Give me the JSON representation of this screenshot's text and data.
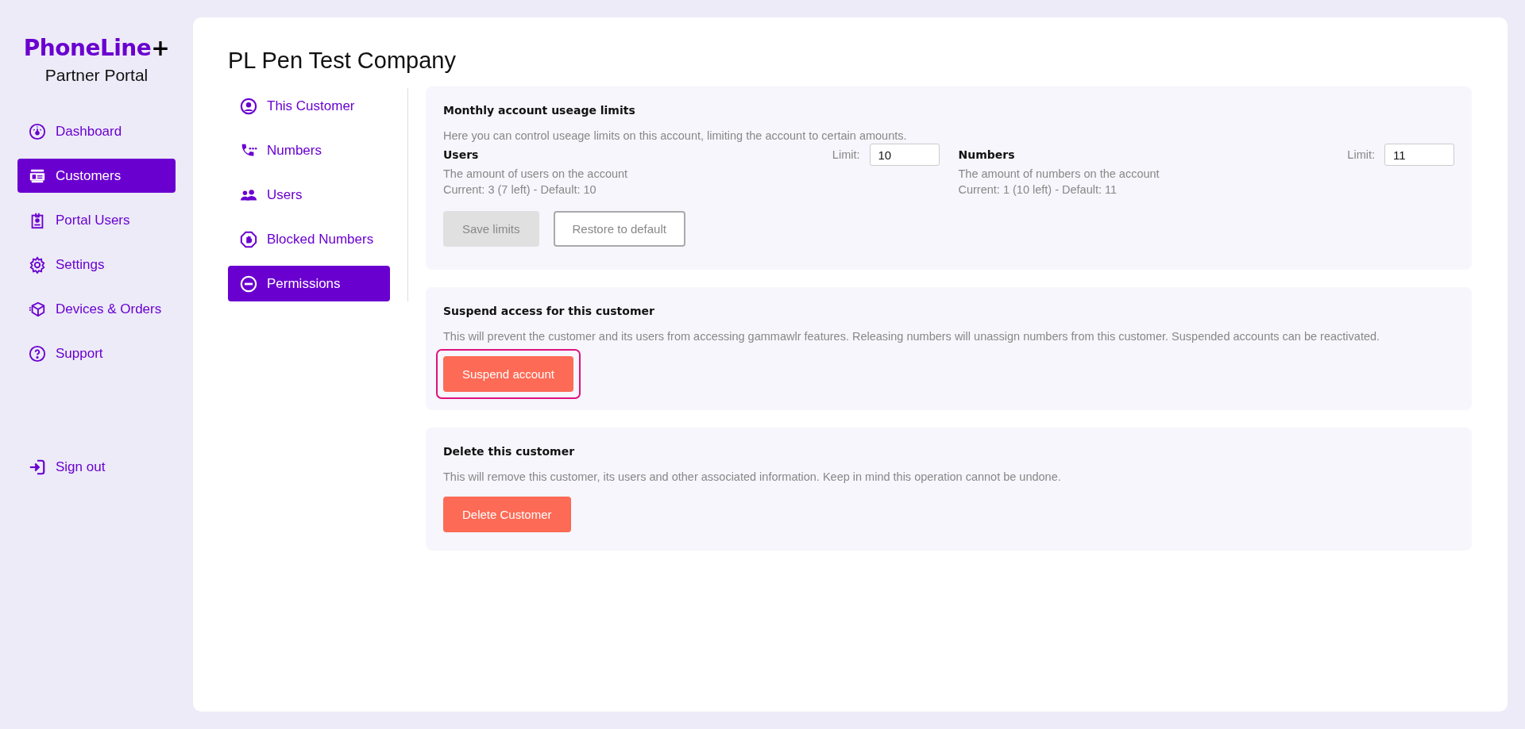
{
  "sidebar": {
    "logo": {
      "name": "PhoneLine",
      "mark": "+"
    },
    "subtitle": "Partner Portal",
    "items": [
      {
        "label": "Dashboard",
        "selected": false
      },
      {
        "label": "Customers",
        "selected": true
      },
      {
        "label": "Portal Users",
        "selected": false
      },
      {
        "label": "Settings",
        "selected": false
      },
      {
        "label": "Devices & Orders",
        "selected": false
      },
      {
        "label": "Support",
        "selected": false
      }
    ],
    "sign_out": "Sign out"
  },
  "page": {
    "title": "PL Pen Test Company"
  },
  "tabs": [
    {
      "label": "This Customer",
      "selected": false
    },
    {
      "label": "Numbers",
      "selected": false
    },
    {
      "label": "Users",
      "selected": false
    },
    {
      "label": "Blocked Numbers",
      "selected": false
    },
    {
      "label": "Permissions",
      "selected": true
    }
  ],
  "limits": {
    "title": "Monthly account useage limits",
    "description": "Here you can control useage limits on this account, limiting the account to certain amounts.",
    "groups": [
      {
        "title": "Users",
        "limit_label": "Limit:",
        "value": "10",
        "description": "The amount of users on the account",
        "current": "Current: 3 (7 left) - Default: 10"
      },
      {
        "title": "Numbers",
        "limit_label": "Limit:",
        "value": "11",
        "description": "The amount of numbers on the account",
        "current": "Current: 1 (10 left) - Default: 11"
      }
    ],
    "buttons": [
      {
        "label": "Save limits",
        "kind": "filled",
        "disabled": true,
        "focused": false
      },
      {
        "label": "Restore to default",
        "kind": "outline",
        "disabled": false,
        "focused": false
      }
    ]
  },
  "sections": [
    {
      "title": "Suspend access for this customer",
      "description": "This will prevent the customer and its users from accessing gammawlr features. Releasing numbers will unassign numbers from this customer. Suspended accounts can be reactivated.",
      "button": {
        "label": "Suspend account",
        "kind": "danger",
        "disabled": false,
        "focused": true
      }
    },
    {
      "title": "Delete this customer",
      "description": "This will remove this customer, its users and other associated information. Keep in mind this operation cannot be undone.",
      "button": {
        "label": "Delete Customer",
        "kind": "danger",
        "disabled": false,
        "focused": false
      }
    }
  ]
}
